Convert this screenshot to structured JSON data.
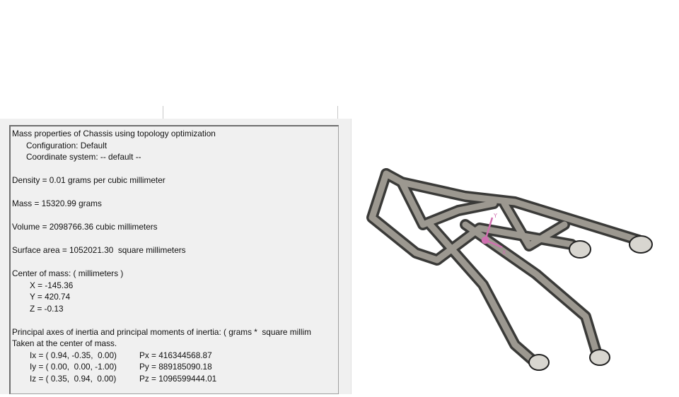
{
  "report": {
    "title": "Mass properties of Chassis using topology optimization",
    "configuration": "Configuration: Default",
    "coordinate_system": "Coordinate system: -- default --",
    "density": "Density = 0.01 grams per cubic millimeter",
    "mass": "Mass = 15320.99 grams",
    "volume": "Volume = 2098766.36 cubic millimeters",
    "surface_area": "Surface area = 1052021.30  square millimeters",
    "com_header": "Center of mass: ( millimeters )",
    "com_x": "X = -145.36",
    "com_y": "Y = 420.74",
    "com_z": "Z = -0.13",
    "principal_header": "Principal axes of inertia and principal moments of inertia: ( grams *  square millim",
    "principal_note": "Taken at the center of mass.",
    "axes": [
      {
        "axis": "Ix = ( 0.94, -0.35,  0.00)",
        "moment": "Px = 416344568.87"
      },
      {
        "axis": "Iy = ( 0.00,  0.00, -1.00)",
        "moment": "Py = 889185090.18"
      },
      {
        "axis": "Iz = ( 0.35,  0.94,  0.00)",
        "moment": "Pz = 1096599444.01"
      }
    ]
  },
  "viewport": {
    "triad_labels": [
      "Y",
      "X"
    ],
    "triad_color": "#d070b0"
  }
}
